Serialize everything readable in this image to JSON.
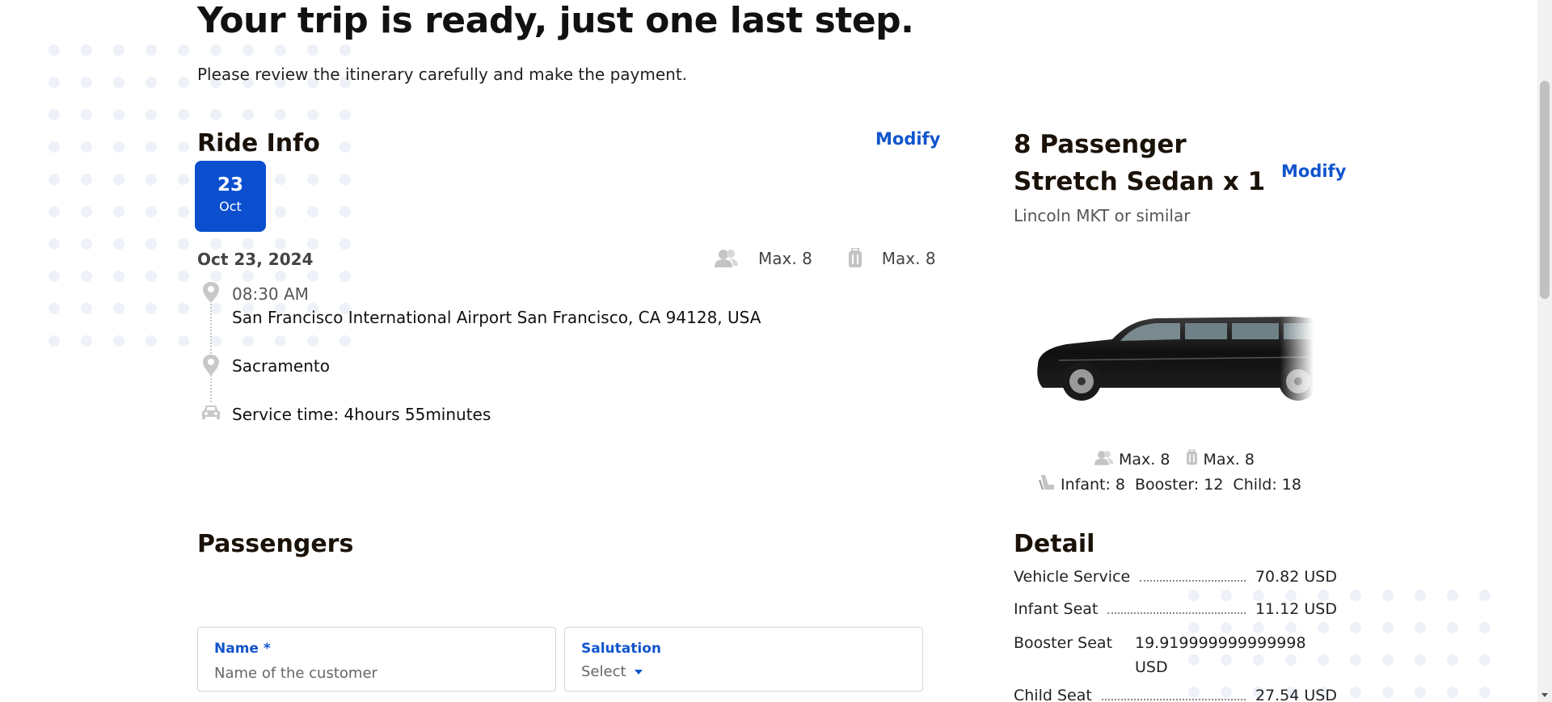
{
  "header": {
    "title": "Your trip is ready, just one last step.",
    "subtitle": "Please review the itinerary carefully and make the payment."
  },
  "ride_info": {
    "heading": "Ride Info",
    "modify_label": "Modify",
    "badge_day": "23",
    "badge_month": "Oct",
    "date": "Oct 23, 2024",
    "max_passengers": "Max. 8",
    "max_luggage": "Max. 8",
    "pickup_time": "08:30 AM",
    "pickup_address": "San Francisco International Airport San Francisco, CA 94128, USA",
    "dropoff": "Sacramento",
    "service_time": "Service time: 4hours 55minutes"
  },
  "vehicle": {
    "title": "8 Passenger Stretch Sedan x 1",
    "subtitle": "Lincoln MKT or similar",
    "modify_label": "Modify",
    "max_passengers": "Max. 8",
    "max_luggage": "Max. 8",
    "infant": "Infant: 8",
    "booster": "Booster: 12",
    "child": "Child: 18"
  },
  "detail": {
    "heading": "Detail",
    "rows": [
      {
        "label": "Vehicle Service",
        "value": "70.82 USD"
      },
      {
        "label": "Infant Seat",
        "value": "11.12 USD"
      },
      {
        "label": "Booster Seat",
        "value": "19.919999999999998 USD"
      },
      {
        "label": "Child Seat",
        "value": "27.54 USD"
      }
    ]
  },
  "passengers": {
    "heading": "Passengers",
    "name_label": "Name *",
    "name_placeholder": "Name of the customer",
    "salutation_label": "Salutation",
    "salutation_value": "Select"
  },
  "colors": {
    "accent": "#1155cc",
    "badge": "#0b4fcf"
  }
}
